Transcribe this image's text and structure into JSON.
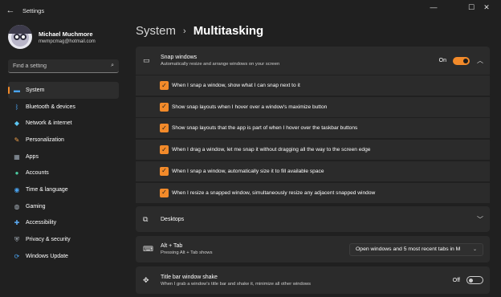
{
  "window": {
    "title": "Settings",
    "controls": [
      "—",
      "☐",
      "✕"
    ]
  },
  "profile": {
    "name": "Michael Muchmore",
    "email": "mwmpcmag@hotmail.com"
  },
  "search": {
    "placeholder": "Find a setting"
  },
  "nav": {
    "items": [
      {
        "label": "System",
        "icon": "monitor-icon",
        "glyph": "▬",
        "color": "#4aa3f0"
      },
      {
        "label": "Bluetooth & devices",
        "icon": "bluetooth-icon",
        "glyph": "ᛒ",
        "color": "#4aa3f0"
      },
      {
        "label": "Network & internet",
        "icon": "wifi-icon",
        "glyph": "◆",
        "color": "#5cc6f2"
      },
      {
        "label": "Personalization",
        "icon": "brush-icon",
        "glyph": "✎",
        "color": "#f0a04a"
      },
      {
        "label": "Apps",
        "icon": "apps-icon",
        "glyph": "▦",
        "color": "#9aa6b2"
      },
      {
        "label": "Accounts",
        "icon": "person-icon",
        "glyph": "●",
        "color": "#4ccba0"
      },
      {
        "label": "Time & language",
        "icon": "globe-clock-icon",
        "glyph": "◉",
        "color": "#4aa3f0"
      },
      {
        "label": "Gaming",
        "icon": "gamepad-icon",
        "glyph": "◍",
        "color": "#aab4be"
      },
      {
        "label": "Accessibility",
        "icon": "accessibility-icon",
        "glyph": "✚",
        "color": "#5aa8f0"
      },
      {
        "label": "Privacy & security",
        "icon": "shield-icon",
        "glyph": "⛨",
        "color": "#aab4be"
      },
      {
        "label": "Windows Update",
        "icon": "update-icon",
        "glyph": "⟳",
        "color": "#4aa3f0"
      }
    ],
    "active_index": 0
  },
  "breadcrumb": {
    "parent": "System",
    "separator": "›",
    "current": "Multitasking"
  },
  "snap": {
    "title": "Snap windows",
    "subtitle": "Automatically resize and arrange windows on your screen",
    "toggle_label": "On",
    "toggle_on": true,
    "options": [
      "When I snap a window, show what I can snap next to it",
      "Show snap layouts when I hover over a window's maximize button",
      "Show snap layouts that the app is part of when I hover over the taskbar buttons",
      "When I drag a window, let me snap it without dragging all the way to the screen edge",
      "When I snap a window, automatically size it to fill available space",
      "When I resize a snapped window, simultaneously resize any adjacent snapped window"
    ]
  },
  "desktops": {
    "title": "Desktops"
  },
  "alttab": {
    "title": "Alt + Tab",
    "subtitle": "Pressing Alt + Tab shows",
    "dropdown_value": "Open windows and 5 most recent tabs in M"
  },
  "shake": {
    "title": "Title bar window shake",
    "subtitle": "When I grab a window's title bar and shake it, minimize all other windows",
    "toggle_label": "Off",
    "toggle_on": false
  },
  "colors": {
    "accent": "#f28a2a",
    "background": "#202020",
    "card": "#2b2b2b"
  }
}
